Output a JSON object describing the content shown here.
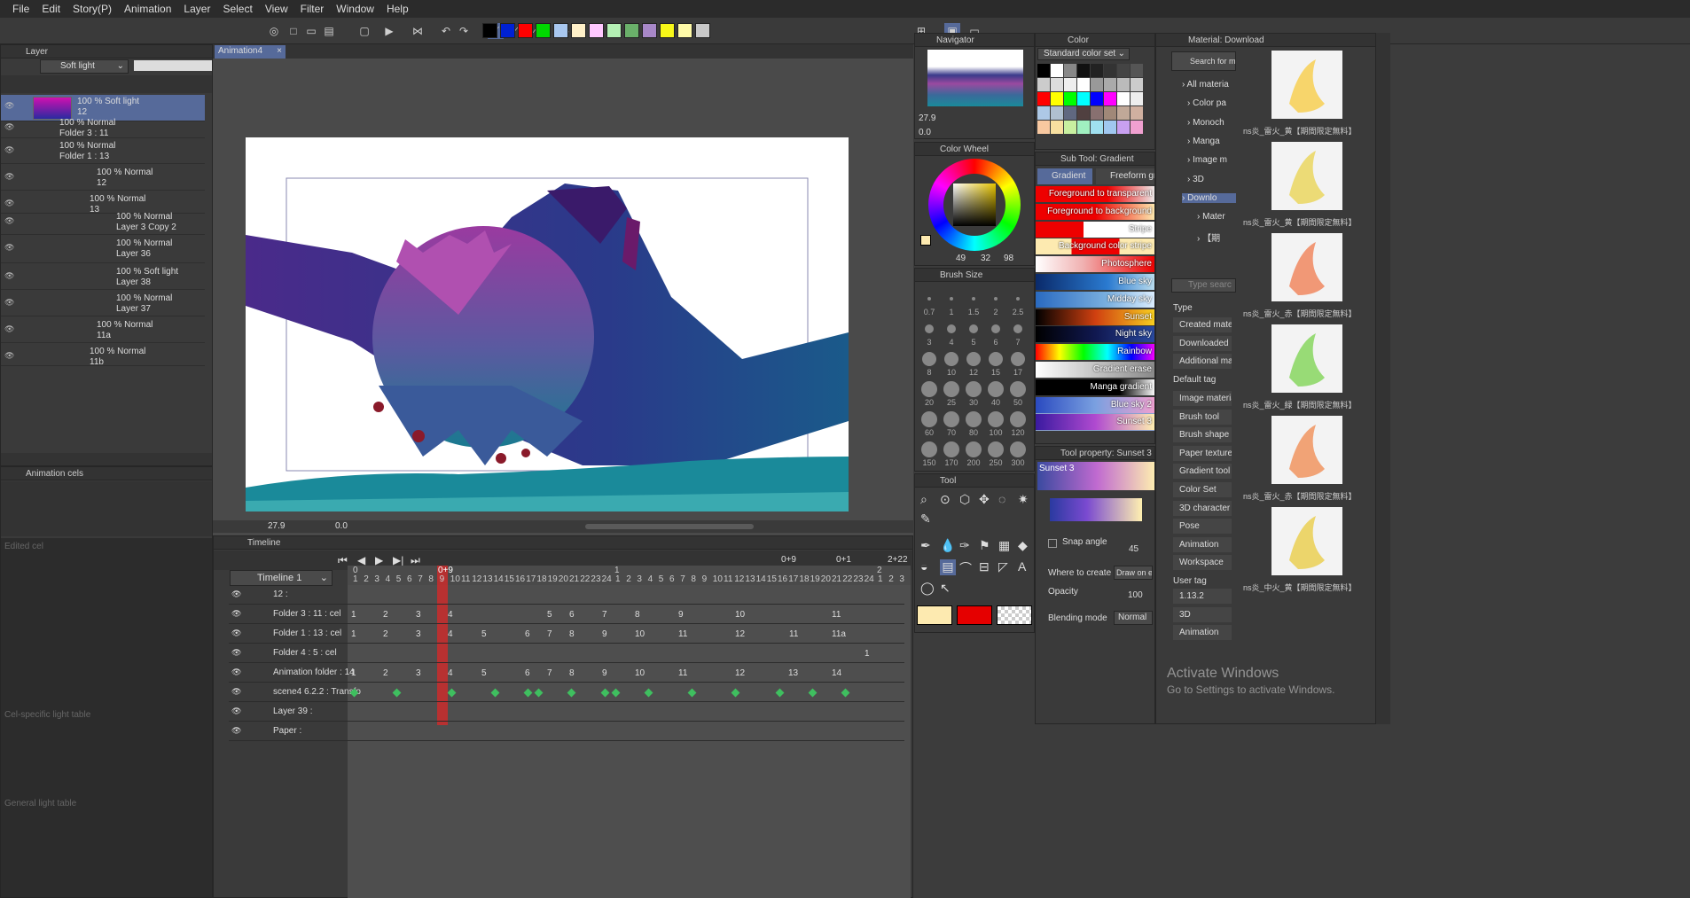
{
  "menu": [
    "File",
    "Edit",
    "Story(P)",
    "Animation",
    "Layer",
    "Select",
    "View",
    "Filter",
    "Window",
    "Help"
  ],
  "colors": {
    "swatches": [
      "#000000",
      "#0021d4",
      "#ff0000",
      "#00d800",
      "#a9c8f0",
      "#fff0c8",
      "#ffc8ff",
      "#b4f0b4",
      "#6ab06a",
      "#a888c8",
      "#f8f818",
      "#fffaa8",
      "#c8c8c8"
    ],
    "main_color": "#fdeab0",
    "sub_color": "#e50000"
  },
  "layer_panel": {
    "title": "Layer",
    "blend_mode": "Soft light",
    "opacity": "100",
    "rows": [
      {
        "l1": "100 % Soft light",
        "l2": "12"
      },
      {
        "l1": "100 % Normal",
        "l2": "Folder 3 : 11"
      },
      {
        "l1": "100 % Normal",
        "l2": "Folder 1 : 13"
      },
      {
        "l1": "100 % Normal",
        "l2": "12"
      },
      {
        "l1": "100 % Normal",
        "l2": "13"
      },
      {
        "l1": "100 % Normal",
        "l2": "Layer 3 Copy 2"
      },
      {
        "l1": "100 % Normal",
        "l2": "Layer 36"
      },
      {
        "l1": "100 % Soft light",
        "l2": "Layer 38"
      },
      {
        "l1": "100 % Normal",
        "l2": "Layer 37"
      },
      {
        "l1": "100 % Normal",
        "l2": "11a"
      },
      {
        "l1": "100 % Normal",
        "l2": "11b"
      }
    ]
  },
  "anim_cels": {
    "title": "Animation cels",
    "edited_cel": "Edited cel",
    "cel_light": "Cel-specific light table",
    "general_light": "General light table"
  },
  "canvas": {
    "tab": "Animation4",
    "zoom": "27.9",
    "angle": "0.0"
  },
  "navigator": {
    "title": "Navigator",
    "zoom": "27.9",
    "angle": "0.0"
  },
  "color_set": {
    "title": "Color",
    "set_name": "Standard color set"
  },
  "color_wheel": {
    "title": "Color Wheel",
    "h": "49",
    "s": "32",
    "v": "98"
  },
  "brush_size": {
    "title": "Brush Size",
    "sizes": [
      "0.7",
      "1",
      "1.5",
      "2",
      "2.5",
      "3",
      "4",
      "5",
      "6",
      "7",
      "8",
      "10",
      "12",
      "15",
      "17",
      "20",
      "25",
      "30",
      "40",
      "50",
      "60",
      "70",
      "80",
      "100",
      "120",
      "150",
      "170",
      "200",
      "250",
      "300"
    ]
  },
  "tool": {
    "title": "Tool"
  },
  "subtool": {
    "title": "Sub Tool: Gradient",
    "tabs": [
      "Gradient",
      "Freeform gr"
    ],
    "items": [
      "Foreground to transparent",
      "Foreground to background",
      "Stripe",
      "Background color stripe",
      "Photosphere",
      "Blue sky",
      "Midday sky",
      "Sunset",
      "Night sky",
      "Rainbow",
      "Gradient erase",
      "Manga gradient",
      "Blue sky 2",
      "Sunset 3"
    ]
  },
  "tool_property": {
    "title": "Tool property: Sunset 3",
    "name": "Sunset 3",
    "snap_angle_label": "Snap angle",
    "snap_angle": "45",
    "where_label": "Where to create",
    "where_value": "Draw on e",
    "opacity_label": "Opacity",
    "opacity": "100",
    "blend_label": "Blending mode",
    "blend_value": "Normal"
  },
  "material": {
    "title": "Material: Download",
    "search_btn": "Search for mate",
    "tree": [
      "All materia",
      "Color pa",
      "Monoch",
      "Manga",
      "Image m",
      "3D",
      "Downlo",
      "Mater",
      "【期"
    ],
    "search_placeholder": "Type searc",
    "type_label": "Type",
    "type_tags": [
      "Created mater",
      "Downloaded m",
      "Additional mat"
    ],
    "default_tag_label": "Default tag",
    "default_tags": [
      "Image materia",
      "Brush tool",
      "Brush shape",
      "Paper texture",
      "Gradient tool",
      "Color Set",
      "3D character",
      "Pose",
      "Animation",
      "Workspace"
    ],
    "user_tag_label": "User tag",
    "user_tags": [
      "1.13.2",
      "3D",
      "Animation"
    ],
    "items": [
      "ns炎_雷火_黄【期間限定無料】炎のループ",
      "ns炎_雷火_黄【期間限定無料】炎のループ",
      "ns炎_雷火_赤【期間限定無料】炎のループ",
      "ns炎_雷火_緑【期間限定無料】炎のループ",
      "ns炎_雷火_赤【期間限定無料】炎のループ",
      "ns炎_中火_黄【期間限定無料】炎のループ"
    ]
  },
  "timeline": {
    "title": "Timeline",
    "name": "Timeline 1",
    "current_frame": "0+9",
    "frame_a": "0+9",
    "frame_b": "0+1",
    "frame_c": "2+22",
    "sec_marks": [
      "0",
      "1",
      "2"
    ],
    "frames1": [
      "1",
      "2",
      "3",
      "4",
      "5",
      "6",
      "7",
      "8",
      "9",
      "10",
      "11",
      "12",
      "13",
      "14",
      "15",
      "16",
      "17",
      "18",
      "19",
      "20",
      "21",
      "22",
      "23",
      "24"
    ],
    "frames2": [
      "1",
      "2",
      "3",
      "4",
      "5",
      "6",
      "7",
      "8",
      "9",
      "10",
      "11",
      "12",
      "13",
      "14",
      "15",
      "16",
      "17",
      "18",
      "19",
      "20",
      "21",
      "22",
      "23",
      "24"
    ],
    "frames3": [
      "1",
      "2",
      "3"
    ],
    "tracks": [
      {
        "name": "12 :"
      },
      {
        "name": "Folder 3 : 11 : cel",
        "cels": [
          "1",
          "2",
          "3",
          "4",
          "5",
          "6",
          "7",
          "8",
          "9",
          "10",
          "11"
        ]
      },
      {
        "name": "Folder 1 : 13 : cel",
        "cels": [
          "1",
          "2",
          "3",
          "4",
          "5",
          "6",
          "7",
          "8",
          "9",
          "10",
          "11",
          "12",
          "11",
          "11a"
        ]
      },
      {
        "name": "Folder 4 : 5 : cel",
        "cels": [
          "1"
        ]
      },
      {
        "name": "Animation folder : 14",
        "cels": [
          "1",
          "2",
          "3",
          "4",
          "5",
          "6",
          "7",
          "8",
          "9",
          "10",
          "11",
          "12",
          "13",
          "14"
        ]
      },
      {
        "name": "scene4 6.2.2 : Transfo"
      },
      {
        "name": "Layer 39 :"
      },
      {
        "name": "Paper :"
      }
    ]
  },
  "watermark": {
    "line1": "Activate Windows",
    "line2": "Go to Settings to activate Windows."
  }
}
